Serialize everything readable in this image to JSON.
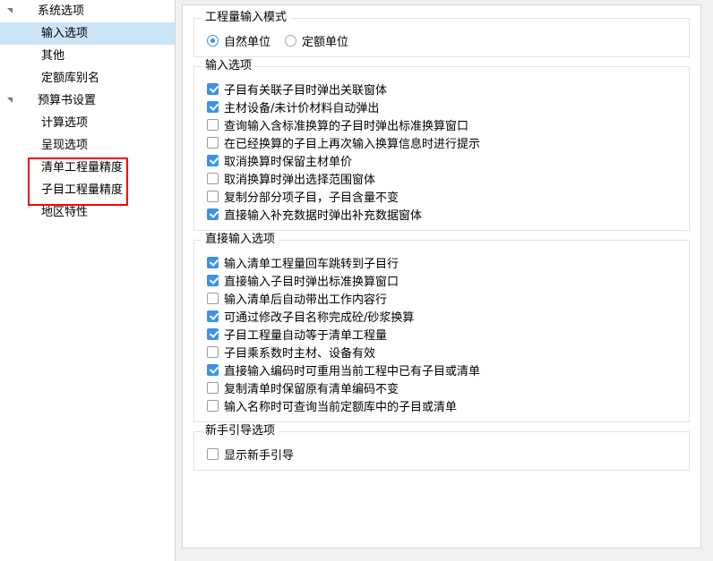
{
  "sidebar": {
    "nodes": [
      {
        "label": "系统选项",
        "level": "root",
        "expanded": true,
        "selected": false
      },
      {
        "label": "输入选项",
        "level": "child",
        "expanded": false,
        "selected": true
      },
      {
        "label": "其他",
        "level": "child",
        "expanded": false,
        "selected": false
      },
      {
        "label": "定额库别名",
        "level": "child",
        "expanded": false,
        "selected": false
      },
      {
        "label": "预算书设置",
        "level": "root",
        "expanded": true,
        "selected": false
      },
      {
        "label": "计算选项",
        "level": "child",
        "expanded": false,
        "selected": false
      },
      {
        "label": "呈现选项",
        "level": "child",
        "expanded": false,
        "selected": false
      },
      {
        "label": "清单工程量精度",
        "level": "child",
        "expanded": false,
        "selected": false
      },
      {
        "label": "子目工程量精度",
        "level": "child",
        "expanded": false,
        "selected": false
      },
      {
        "label": "地区特性",
        "level": "child",
        "expanded": false,
        "selected": false
      }
    ],
    "annotation": {
      "color": "#ff0000",
      "targets": [
        "清单工程量精度",
        "子目工程量精度"
      ]
    }
  },
  "panel": {
    "groups": [
      {
        "legend": "工程量输入模式",
        "type": "radio",
        "options": [
          {
            "label": "自然单位",
            "selected": true
          },
          {
            "label": "定额单位",
            "selected": false
          }
        ]
      },
      {
        "legend": "输入选项",
        "type": "checkbox",
        "options": [
          {
            "label": "子目有关联子目时弹出关联窗体",
            "checked": true
          },
          {
            "label": "主材设备/未计价材料自动弹出",
            "checked": true
          },
          {
            "label": "查询输入含标准换算的子目时弹出标准换算窗口",
            "checked": false
          },
          {
            "label": "在已经换算的子目上再次输入换算信息时进行提示",
            "checked": false
          },
          {
            "label": "取消换算时保留主材单价",
            "checked": true
          },
          {
            "label": "取消换算时弹出选择范围窗体",
            "checked": false
          },
          {
            "label": "复制分部分项子目，子目含量不变",
            "checked": false
          },
          {
            "label": "直接输入补充数据时弹出补充数据窗体",
            "checked": true
          }
        ]
      },
      {
        "legend": "直接输入选项",
        "type": "checkbox",
        "options": [
          {
            "label": "输入清单工程量回车跳转到子目行",
            "checked": true
          },
          {
            "label": "直接输入子目时弹出标准换算窗口",
            "checked": true
          },
          {
            "label": "输入清单后自动带出工作内容行",
            "checked": false
          },
          {
            "label": "可通过修改子目名称完成砼/砂浆换算",
            "checked": true
          },
          {
            "label": "子目工程量自动等于清单工程量",
            "checked": true
          },
          {
            "label": "子目乘系数时主材、设备有效",
            "checked": false
          },
          {
            "label": "直接输入编码时可重用当前工程中已有子目或清单",
            "checked": true
          },
          {
            "label": "复制清单时保留原有清单编码不变",
            "checked": false
          },
          {
            "label": "输入名称时可查询当前定额库中的子目或清单",
            "checked": false
          }
        ]
      },
      {
        "legend": "新手引导选项",
        "type": "checkbox",
        "options": [
          {
            "label": "显示新手引导",
            "checked": false
          }
        ]
      }
    ]
  },
  "colors": {
    "accent": "#3c92e8",
    "selection": "#cce4f7",
    "annotation": "#ff0000",
    "panel_bg": "#ffffff",
    "app_bg": "#f0f0f0",
    "border": "#e2e2e2"
  }
}
